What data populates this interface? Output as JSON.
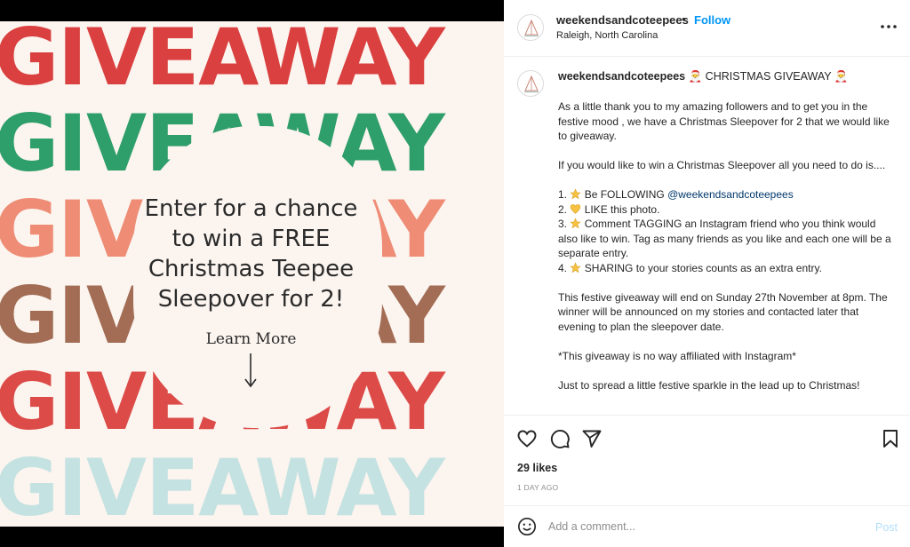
{
  "media": {
    "rows": [
      {
        "text": "GIVEAWAY",
        "color": "#d9403f"
      },
      {
        "text": "GIVEAWAY",
        "color": "#2e9e6a"
      },
      {
        "text": "GIVEAWAY",
        "color": "#ef8c75"
      },
      {
        "text": "GIVEAWAY",
        "color": "#a36d55"
      },
      {
        "text": "GIVEAWAY",
        "color": "#dc4b48"
      },
      {
        "text": "GIVEAWAY",
        "color": "#c4e2e1"
      }
    ],
    "center_line1": "Enter for a chance",
    "center_line2": "to win a FREE",
    "center_line3": "Christmas Teepee",
    "center_line4": "Sleepover for 2!",
    "learn_more": "Learn More",
    "arrow_icon": "down-arrow-icon"
  },
  "header": {
    "username": "weekendsandcoteepees",
    "separator": "•",
    "follow_label": "Follow",
    "location": "Raleigh, North Carolina",
    "more_icon": "more-horizontal-icon"
  },
  "caption": {
    "username": "weekendsandcoteepees",
    "title": "CHRISTMAS GIVEAWAY",
    "santa_emoji": "🎅",
    "para1": "As a little thank you to my amazing followers and to get you in the festive mood , we have a Christmas Sleepover for 2 that we would like to giveaway.",
    "para2": "If you would like to win a Christmas Sleepover all you need to do is....",
    "step1_prefix": "1.",
    "step1_text": "Be FOLLOWING",
    "step1_mention": "@weekendsandcoteepees",
    "step2_prefix": "2.",
    "step2_text": "LIKE this photo.",
    "step3_prefix": "3.",
    "step3_text": "Comment TAGGING an Instagram friend who you think would also like to win. Tag as many friends as you like and each one will be a separate entry.",
    "step4_prefix": "4.",
    "step4_text": "SHARING to your stories counts as an extra entry.",
    "para3": "This festive giveaway will end on Sunday 27th November at 8pm. The winner will be announced on my stories and contacted later that evening to plan the sleepover date.",
    "para4": "*This giveaway is no way affiliated with Instagram*",
    "para5": "Just to spread a little festive sparkle in the lead up to Christmas!"
  },
  "actions": {
    "like_icon": "heart-icon",
    "comment_icon": "comment-icon",
    "share_icon": "send-icon",
    "save_icon": "bookmark-icon",
    "likes": "29 likes",
    "time_ago": "1 DAY AGO"
  },
  "comment": {
    "emoji_icon": "smiley-icon",
    "placeholder": "Add a comment...",
    "post_label": "Post"
  },
  "colors": {
    "follow": "#0095f6",
    "mention": "#00376b",
    "post_disabled": "#b2dffc"
  }
}
